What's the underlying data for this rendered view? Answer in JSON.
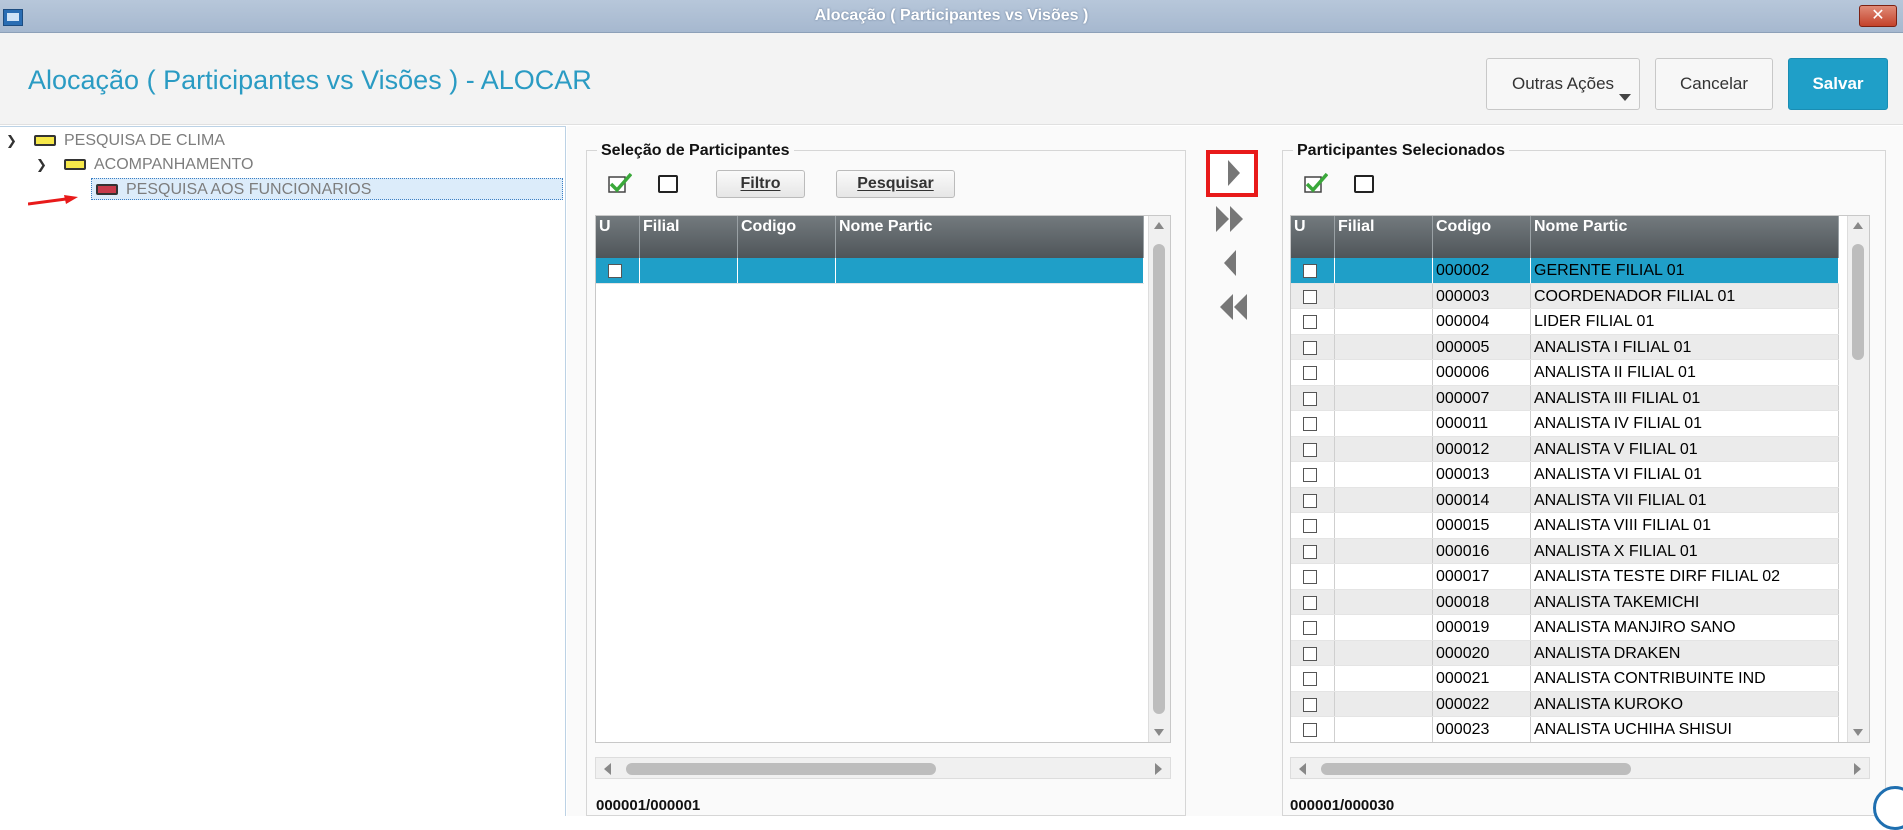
{
  "window": {
    "title": "Alocação ( Participantes vs Visões )",
    "close_label": "✕"
  },
  "header": {
    "page_title": "Alocação ( Participantes vs Visões ) - ALOCAR",
    "more_actions_label": "Outras Ações",
    "cancel_label": "Cancelar",
    "save_label": "Salvar"
  },
  "tree": [
    {
      "label": "PESQUISA DE CLIMA",
      "level": 0,
      "color": "yellow"
    },
    {
      "label": "ACOMPANHAMENTO",
      "level": 1,
      "color": "yellow"
    },
    {
      "label": "PESQUISA AOS FUNCIONARIOS",
      "level": 2,
      "color": "red",
      "selected": true
    }
  ],
  "selection_panel": {
    "title": "Seleção de Participantes",
    "filter_label": "Filtro",
    "search_label": "Pesquisar",
    "columns": [
      "U",
      "Filial",
      "Codigo",
      "Nome  Partic"
    ],
    "counter": "000001/000001"
  },
  "selected_panel": {
    "title": "Participantes Selecionados",
    "columns": [
      "U",
      "Filial",
      "Codigo",
      "Nome  Partic"
    ],
    "counter": "000001/000030",
    "rows": [
      {
        "codigo": "000002",
        "nome": "GERENTE FILIAL 01"
      },
      {
        "codigo": "000003",
        "nome": "COORDENADOR FILIAL 01"
      },
      {
        "codigo": "000004",
        "nome": "LIDER FILIAL 01"
      },
      {
        "codigo": "000005",
        "nome": "ANALISTA I FILIAL 01"
      },
      {
        "codigo": "000006",
        "nome": "ANALISTA II FILIAL 01"
      },
      {
        "codigo": "000007",
        "nome": "ANALISTA III FILIAL 01"
      },
      {
        "codigo": "000011",
        "nome": "ANALISTA IV FILIAL 01"
      },
      {
        "codigo": "000012",
        "nome": "ANALISTA V FILIAL 01"
      },
      {
        "codigo": "000013",
        "nome": "ANALISTA VI FILIAL 01"
      },
      {
        "codigo": "000014",
        "nome": "ANALISTA VII FILIAL 01"
      },
      {
        "codigo": "000015",
        "nome": "ANALISTA VIII FILIAL 01"
      },
      {
        "codigo": "000016",
        "nome": "ANALISTA X FILIAL 01"
      },
      {
        "codigo": "000017",
        "nome": "ANALISTA TESTE DIRF FILIAL 02"
      },
      {
        "codigo": "000018",
        "nome": "ANALISTA TAKEMICHI"
      },
      {
        "codigo": "000019",
        "nome": "ANALISTA MANJIRO SANO"
      },
      {
        "codigo": "000020",
        "nome": "ANALISTA DRAKEN"
      },
      {
        "codigo": "000021",
        "nome": "ANALISTA CONTRIBUINTE IND"
      },
      {
        "codigo": "000022",
        "nome": "ANALISTA KUROKO"
      },
      {
        "codigo": "000023",
        "nome": "ANALISTA UCHIHA SHISUI"
      }
    ]
  },
  "colors": {
    "accent": "#1f9fc8",
    "title": "#2a9bc3",
    "highlight": "#e81a1a"
  }
}
